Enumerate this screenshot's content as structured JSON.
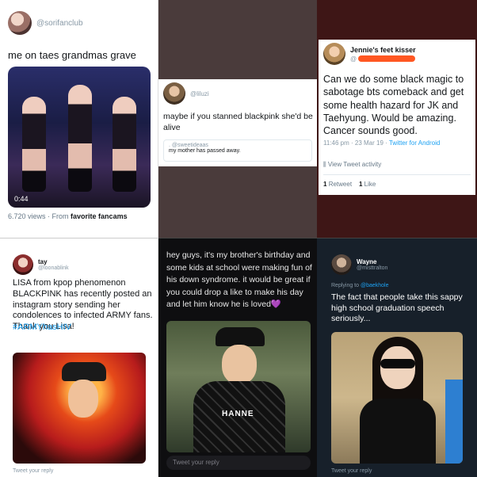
{
  "panels": [
    {
      "handle": "@sorifanclub",
      "text": "me on taes grandmas grave",
      "video_duration": "0:44",
      "views": "6.720 views · From",
      "views_source": "favorite fancams"
    },
    {
      "handle": "@liluzi",
      "text": "maybe if you stanned blackpink she'd be alive",
      "quoted_handle": ". @sweetideaas",
      "quoted_text": "my mother has passed away."
    },
    {
      "name": "Jennie's feet kisser",
      "handle_prefix": "@",
      "text": "Can we do some black magic to sabotage bts comeback and get some health hazard for JK and Taehyung.  Would be amazing. Cancer sounds good.",
      "timestamp": "11:46 pm · 23 Mar 19 ·",
      "client": "Twitter for Android",
      "activity": "View Tweet activity",
      "retweets": "1",
      "retweets_label": "Retweet",
      "likes": "1",
      "likes_label": "Like",
      "redaction_color": "#ff5722"
    },
    {
      "name": "tay",
      "handle": "@loonablink",
      "text": "LISA from kpop phenomenon BLACKPINK has recently posted an instagram story sending her condolences to infected ARMY fans. Thank you Lisa!",
      "hashtag": "#ARMYhasHIV",
      "reply": "Tweet your reply"
    },
    {
      "text": "hey guys, it's my brother's birthday and some kids at school were making fun of his down syndrome. it would be great if you could drop a like to make his day and let him know he is loved💜",
      "jacket_text": "HANNE",
      "reply": "Tweet your reply"
    },
    {
      "name": "Wayne",
      "handle": "@misttralton",
      "replying_label": "Replying to",
      "replying_handle": "@baekhole",
      "text": "The fact that people take this sappy high school graduation speech seriously...",
      "reply": "Tweet your reply"
    }
  ],
  "colors": {
    "link_blue": "#1da1f2",
    "muted_gray": "#8899a6"
  },
  "icons": [
    "avatar",
    "video-play",
    "activity-bars-icon"
  ]
}
